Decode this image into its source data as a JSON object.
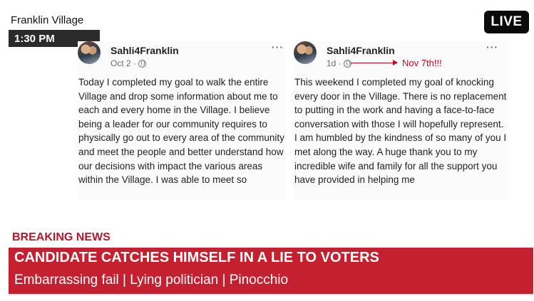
{
  "header": {
    "location": "Franklin Village",
    "time": "1:30 PM",
    "live": "LIVE"
  },
  "posts": [
    {
      "author": "Sahli4Franklin",
      "date": "Oct 2 ·",
      "more": "···",
      "body": "Today I completed my goal to walk the entire Village and drop some information about me to each and every home in the Village. I believe being a leader for our community requires to physically go out to every area of the community and meet the people and better understand how our decisions with impact the various areas within the Village. I was able to meet so"
    },
    {
      "author": "Sahli4Franklin",
      "date": "1d ·",
      "more": "···",
      "annotation": "Nov 7th!!!",
      "body": "This weekend I completed my goal of knocking every door in the Village. There is no replacement to putting in the work and having a face-to-face conversation with those I will hopefully represent.  I am humbled by the kindness of so many of you I met along the way. A huge thank you to my incredible wife and family for all the support you have provided in helping me"
    }
  ],
  "ticker": {
    "label": "BREAKING NEWS",
    "headline": "CANDIDATE CATCHES HIMSELF IN A LIE TO VOTERS",
    "subline": "Embarrassing fail | Lying politician | Pinocchio"
  },
  "colors": {
    "accent_red": "#c4202f",
    "annotation_red": "#d0021b",
    "badge_dark": "#2b2b2b"
  }
}
